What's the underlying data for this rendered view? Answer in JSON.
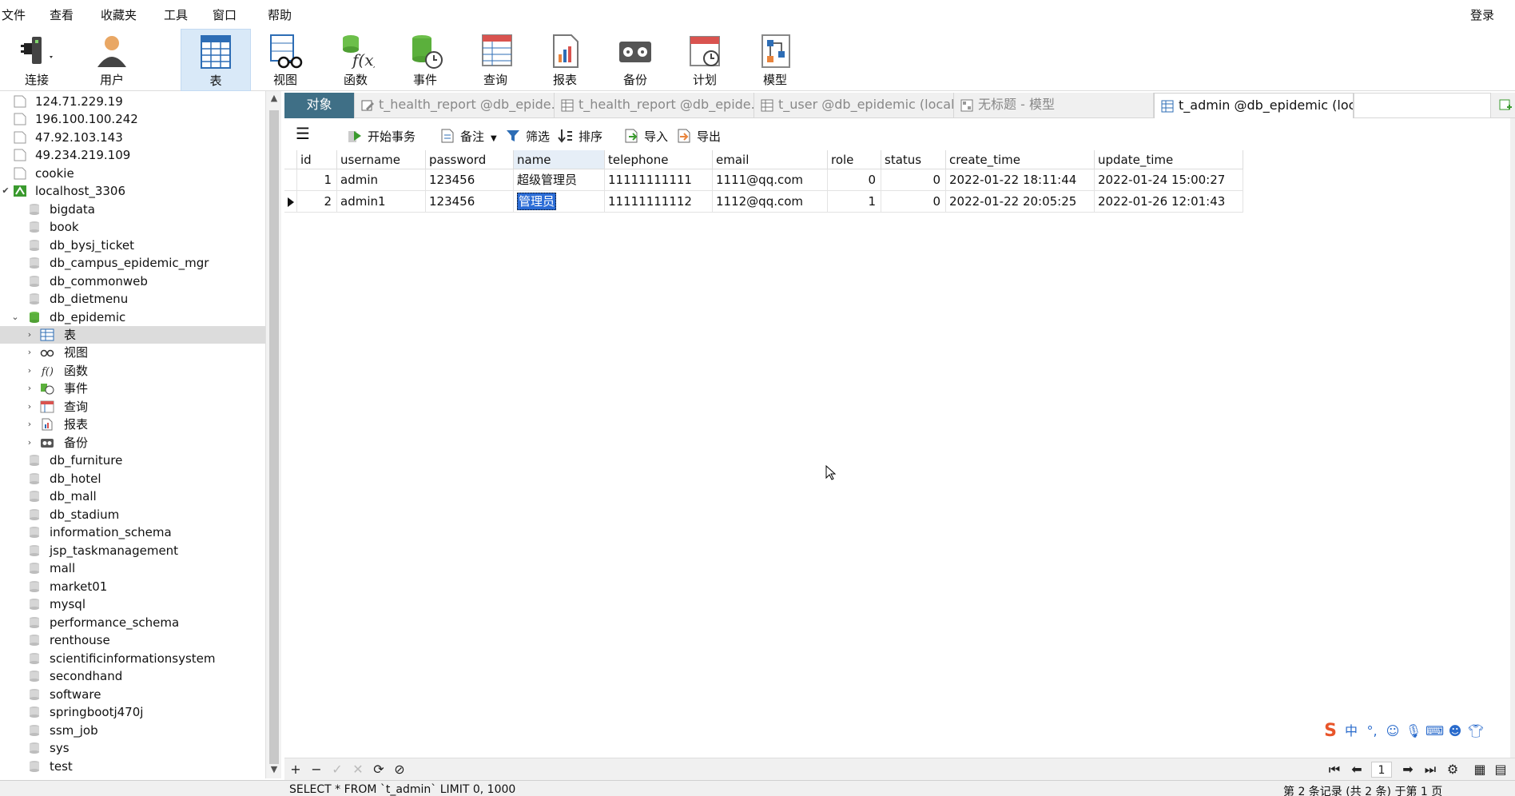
{
  "menu": {
    "items": [
      "文件",
      "查看",
      "收藏夹",
      "工具",
      "窗口",
      "帮助"
    ],
    "login": "登录"
  },
  "toolbar": {
    "buttons": [
      {
        "label": "连接",
        "icon": "plug-connection-icon"
      },
      {
        "label": "用户",
        "icon": "user-icon"
      },
      {
        "label": "表",
        "icon": "table-icon",
        "active": true
      },
      {
        "label": "视图",
        "icon": "view-glasses-icon"
      },
      {
        "label": "函数",
        "icon": "function-icon"
      },
      {
        "label": "事件",
        "icon": "event-clock-icon"
      },
      {
        "label": "查询",
        "icon": "query-icon"
      },
      {
        "label": "报表",
        "icon": "report-icon"
      },
      {
        "label": "备份",
        "icon": "backup-icon"
      },
      {
        "label": "计划",
        "icon": "schedule-calendar-icon"
      },
      {
        "label": "模型",
        "icon": "model-icon"
      }
    ]
  },
  "tree": {
    "connections": [
      "124.71.229.19",
      "196.100.100.242",
      "47.92.103.143",
      "49.234.219.109",
      "cookie",
      "localhost_3306"
    ],
    "databases_before": [
      "bigdata",
      "book",
      "db_bysj_ticket",
      "db_campus_epidemic_mgr",
      "db_commonweb",
      "db_dietmenu",
      "db_epidemic"
    ],
    "epidemic_children": [
      "表",
      "视图",
      "函数",
      "事件",
      "查询",
      "报表",
      "备份"
    ],
    "databases_after": [
      "db_furniture",
      "db_hotel",
      "db_mall",
      "db_stadium",
      "information_schema",
      "jsp_taskmanagement",
      "mall",
      "market01",
      "mysql",
      "performance_schema",
      "renthouse",
      "scientificinformationsystem",
      "secondhand",
      "software",
      "springbootj470j",
      "ssm_job",
      "sys",
      "test"
    ]
  },
  "tabs": {
    "objects": "对象",
    "items": [
      "t_health_report @db_epide...",
      "t_health_report @db_epide...",
      "t_user @db_epidemic (local...",
      "无标题 - 模型",
      "t_admin @db_epidemic (loc..."
    ]
  },
  "subtoolbar": {
    "begin_tx": "开始事务",
    "memo": "备注",
    "filter": "筛选",
    "sort": "排序",
    "import": "导入",
    "export": "导出"
  },
  "grid": {
    "columns": [
      "id",
      "username",
      "password",
      "name",
      "telephone",
      "email",
      "role",
      "status",
      "create_time",
      "update_time"
    ],
    "rows": [
      [
        "1",
        "admin",
        "123456",
        "超级管理员",
        "11111111111",
        "1111@qq.com",
        "0",
        "0",
        "2022-01-22 18:11:44",
        "2022-01-24 15:00:27"
      ],
      [
        "2",
        "admin1",
        "123456",
        "管理员",
        "11111111112",
        "1112@qq.com",
        "1",
        "0",
        "2022-01-22 20:05:25",
        "2022-01-26 12:01:43"
      ]
    ]
  },
  "pager": {
    "page": "1"
  },
  "status": {
    "sql": "SELECT * FROM `t_admin` LIMIT 0, 1000",
    "records": "第 2 条记录 (共 2 条) 于第 1 页"
  },
  "ime": {
    "label": "中"
  }
}
